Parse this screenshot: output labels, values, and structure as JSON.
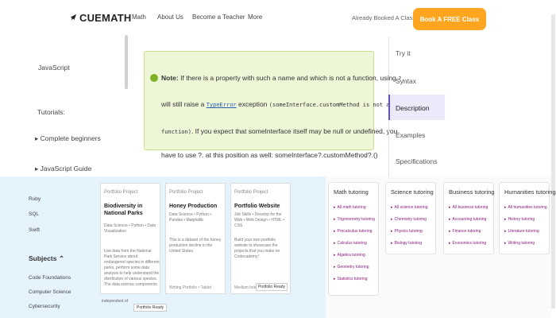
{
  "header": {
    "logo": "CUEMATH",
    "nav": [
      "Math",
      "About Us",
      "Become a Teacher",
      "More"
    ],
    "already_booked": "Already Booked A Class?",
    "cta": "Book A FREE Class"
  },
  "sidebar": {
    "items": [
      "JavaScript",
      "Tutorials:",
      "Complete beginners",
      "JavaScript Guide"
    ]
  },
  "note": {
    "label": "Note:",
    "line1": "If there is a property with such a name and which is not a function, using",
    "line1_code": "?.",
    "line2_pre": "will still raise a",
    "type_error": "TypeError",
    "line2_mid": "exception",
    "line2_code": "(someInterface.customMethod is not a",
    "line3_code": "function)",
    "line3_post": ". If you expect that someInterface itself may be null or undefined, you",
    "after": "have to use ?. at this position as well: someInterface?.customMethod?.()"
  },
  "toc": {
    "items": [
      "Try it",
      "Syntax",
      "Description",
      "Examples",
      "Specifications"
    ],
    "active": "Description"
  },
  "projects": {
    "side_items": [
      "Ruby",
      "SQL",
      "Swift"
    ],
    "subjects": "Subjects",
    "side_items2": [
      "Code Foundations",
      "Computer Science",
      "Cybersecurity"
    ],
    "cards": [
      {
        "tag": "Portfolio Project",
        "title": "Biodiversity in National Parks",
        "skills": "Data Science • Python • Data Visualization",
        "desc": "Use data from the National Park Service about endangered species in different parks, perform some data analysis to help understand the distribution of various species. The data science components"
      },
      {
        "tag": "Portfolio Project",
        "title": "Honey Production",
        "skills": "Data Science • Python • Pandas • Matplotlib",
        "desc": "This is a dataset of the honey production decline in the United States.",
        "foot": "Writing Portfolio • Tablet"
      },
      {
        "tag": "Portfolio Project",
        "title": "Portfolio Website",
        "skills": "Job Skills • Develop for the Web • Web Design • HTML • CSS",
        "desc": "Build your own portfolio website to showcase the projects that you make on Codecademy!",
        "foot": "Medium Intermediate",
        "ready": "Portfolio Ready"
      }
    ],
    "card1_extra": "independent of",
    "card1_ready": "Portfolio Ready"
  },
  "tutoring": [
    {
      "title": "Math tutoring",
      "links": [
        "All math tutoring",
        "Trigonometry tutoring",
        "Precalculus tutoring",
        "Calculus tutoring",
        "Algebra tutoring",
        "Geometry tutoring",
        "Statistics tutoring"
      ]
    },
    {
      "title": "Science tutoring",
      "links": [
        "All science tutoring",
        "Chemistry tutoring",
        "Physics tutoring",
        "Biology tutoring"
      ]
    },
    {
      "title": "Business tutoring",
      "links": [
        "All business tutoring",
        "Accounting tutoring",
        "Finance tutoring",
        "Economics tutoring"
      ]
    },
    {
      "title": "Humanities tutoring",
      "links": [
        "All humanities tutoring",
        "History tutoring",
        "Literature tutoring",
        "Writing tutoring"
      ]
    }
  ]
}
